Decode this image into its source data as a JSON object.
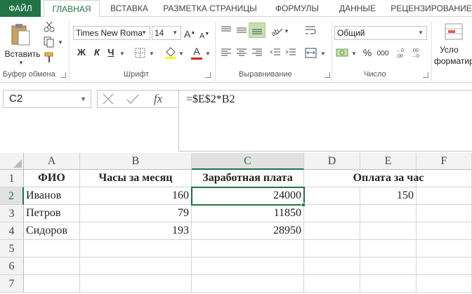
{
  "tabs": [
    "ФАЙЛ",
    "ГЛАВНАЯ",
    "ВСТАВКА",
    "РАЗМЕТКА СТРАНИЦЫ",
    "ФОРМУЛЫ",
    "ДАННЫЕ",
    "РЕЦЕНЗИРОВАНИЕ"
  ],
  "ribbon": {
    "paste_label": "Вставить",
    "groups": {
      "clipboard": "Буфер обмена",
      "font": "Шрифт",
      "alignment": "Выравнивание",
      "number": "Число"
    },
    "font_name": "Times New Roma",
    "font_size": "14",
    "number_format": "Общий",
    "bold": "Ж",
    "italic": "К",
    "underline": "Ч",
    "grow_font": "A",
    "shrink_font": "A",
    "font_color_letter": "A",
    "cond_format_line1": "Усло",
    "cond_format_line2": "форматир",
    "percent": "%",
    "comma": "000"
  },
  "formula_bar": {
    "name_box": "C2",
    "fx": "fx",
    "formula": "=$E$2*B2"
  },
  "sheet": {
    "columns": [
      "A",
      "B",
      "C",
      "D",
      "E",
      "F"
    ],
    "selected_column": "C",
    "rows": [
      "1",
      "2",
      "3",
      "4",
      "5",
      "6",
      "7"
    ],
    "selected_row": "2",
    "cells": {
      "A1": "ФИО",
      "B1": "Часы за месяц",
      "C1": "Заработная плата",
      "D1": "Оплата за час",
      "A2": "Иванов",
      "B2": "160",
      "C2": "24000",
      "E2": "150",
      "A3": "Петров",
      "B3": "79",
      "C3": "11850",
      "A4": "Сидоров",
      "B4": "193",
      "C4": "28950"
    }
  },
  "colors": {
    "accent": "#217346"
  }
}
